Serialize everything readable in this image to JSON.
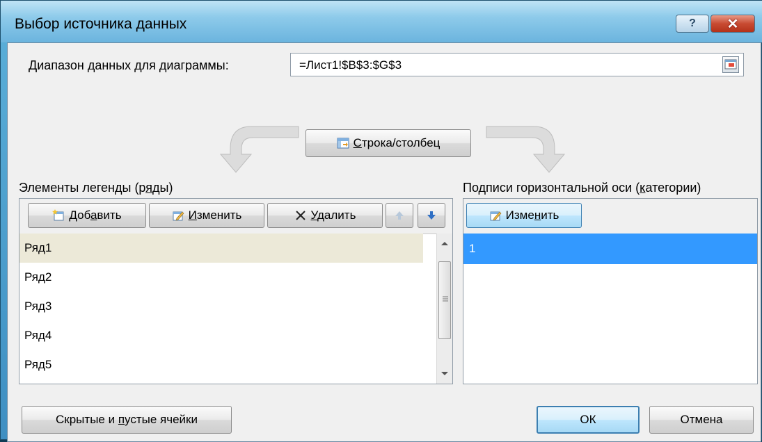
{
  "window": {
    "title": "Выбор источника данных",
    "help_glyph": "?",
    "close_glyph": "✕"
  },
  "range": {
    "label": "Диапазон данных для диаграммы:",
    "value": "=Лист1!$B$3:$G$3"
  },
  "switch_button": {
    "pre": "",
    "accel": "С",
    "post": "трока/столбец"
  },
  "legend": {
    "header_pre": "Элементы легенды (р",
    "header_accel": "я",
    "header_post": "ды)",
    "add": {
      "pre": "Доб",
      "accel": "а",
      "post": "вить"
    },
    "edit": {
      "pre": "",
      "accel": "И",
      "post": "зменить"
    },
    "delete": {
      "pre": "",
      "accel": "У",
      "post": "далить"
    },
    "series": [
      "Ряд1",
      "Ряд2",
      "Ряд3",
      "Ряд4",
      "Ряд5"
    ],
    "selected_index": 0
  },
  "categories": {
    "header_pre": "Подписи горизонтальной оси (",
    "header_accel": "к",
    "header_post": "атегории)",
    "edit": {
      "pre": "Изме",
      "accel": "н",
      "post": "ить"
    },
    "items": [
      "1"
    ]
  },
  "footer": {
    "hidden_cells": {
      "pre": "Скрытые и ",
      "accel": "п",
      "post": "устые ячейки"
    },
    "ok": "ОК",
    "cancel": "Отмена"
  },
  "colors": {
    "selection": "#3399ff",
    "row_highlight": "#ece9d8",
    "close": "#c84b32"
  }
}
